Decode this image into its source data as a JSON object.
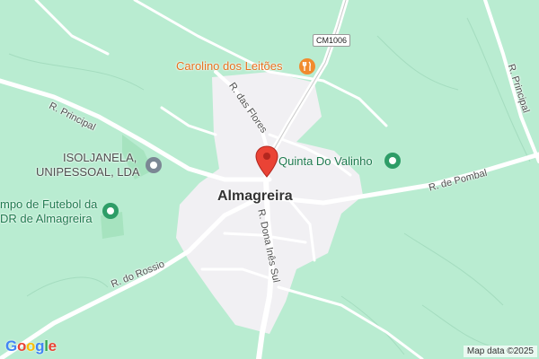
{
  "map": {
    "town_label": "Almagreira",
    "attribution": "Map data ©2025",
    "logo_letters": [
      "G",
      "o",
      "o",
      "g",
      "l",
      "e"
    ],
    "logo_colors": [
      "#4285F4",
      "#EA4335",
      "#FBBC05",
      "#4285F4",
      "#34A853",
      "#EA4335"
    ],
    "road_shield": "CM1006",
    "roads": {
      "principal_west": "R. Principal",
      "principal_east": "R. Principal",
      "das_flores": "R. das Flores",
      "dona_ines": "R. Dona Inês Sul",
      "pombal": "R. de Pombal",
      "rossio": "R. do Rossio"
    },
    "pois": {
      "restaurant": "Carolino dos Leitões",
      "quinta": "Quinta Do Valinho",
      "company_line1": "ISOLJANELA,",
      "company_line2": "UNIPESSOAL, LDA",
      "football_line1": "mpo de Futebol da",
      "football_line2": "DR de Almagreira"
    },
    "colors": {
      "background": "#b9ecd1",
      "urban": "#f1f0f3",
      "road": "#ffffff",
      "marker": "#ea4335",
      "restaurant": "#f18b2e",
      "park_poi": "#2e9d67",
      "company_poi": "#7b8794"
    }
  }
}
